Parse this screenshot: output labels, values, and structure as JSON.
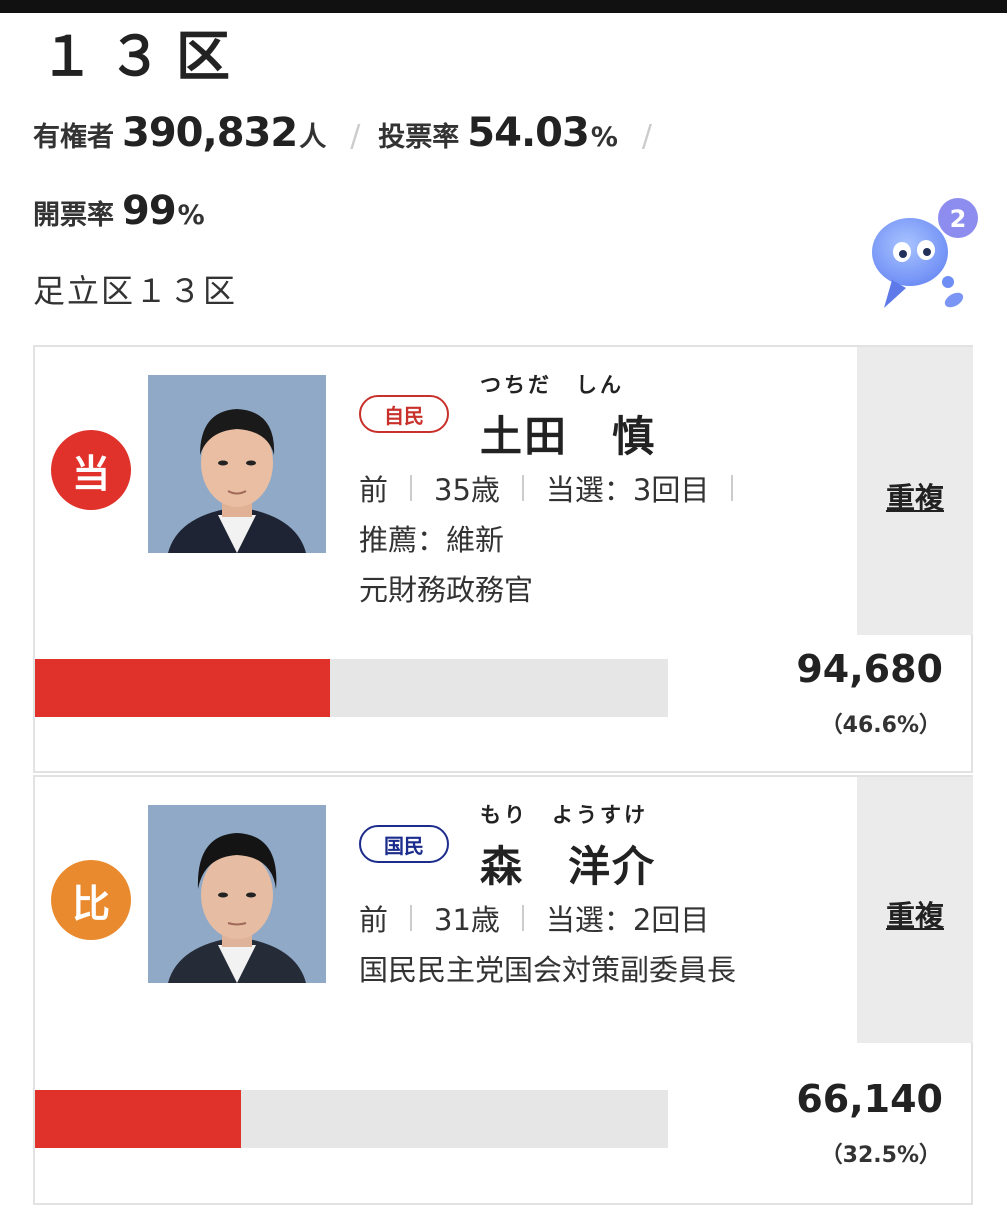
{
  "district": {
    "title": "１３区",
    "area": "足立区１３区"
  },
  "stats": {
    "electorate_label": "有権者",
    "electorate_value": "390,832",
    "electorate_unit": "人",
    "turnout_label": "投票率",
    "turnout_value": "54.03",
    "turnout_unit": "%",
    "counted_label": "開票率",
    "counted_value": "99",
    "counted_unit": "%",
    "separator": "/"
  },
  "mascot": {
    "badge_count": "2",
    "icon": "mascot-icon"
  },
  "candidates": [
    {
      "result": "当",
      "result_color": "#e0312a",
      "party": "自民",
      "party_color": "#c8312b",
      "kana": "つちだ　しん",
      "name": "土田　慎",
      "status": "前",
      "age": "35歳",
      "wins": "当選：3回目",
      "recommend": "推薦：維新",
      "career": "元財務政務官",
      "dup_label": "重複",
      "votes": "94,680",
      "pct": "（46.6%）",
      "pct_value": 46.6
    },
    {
      "result": "比",
      "result_color": "#ea8a2e",
      "party": "国民",
      "party_color": "#1c2c8c",
      "kana": "もり　ようすけ",
      "name": "森　洋介",
      "status": "前",
      "age": "31歳",
      "wins": "当選：2回目",
      "career": "国民民主党国会対策副委員長",
      "dup_label": "重複",
      "votes": "66,140",
      "pct": "（32.5%）",
      "pct_value": 32.5
    }
  ]
}
